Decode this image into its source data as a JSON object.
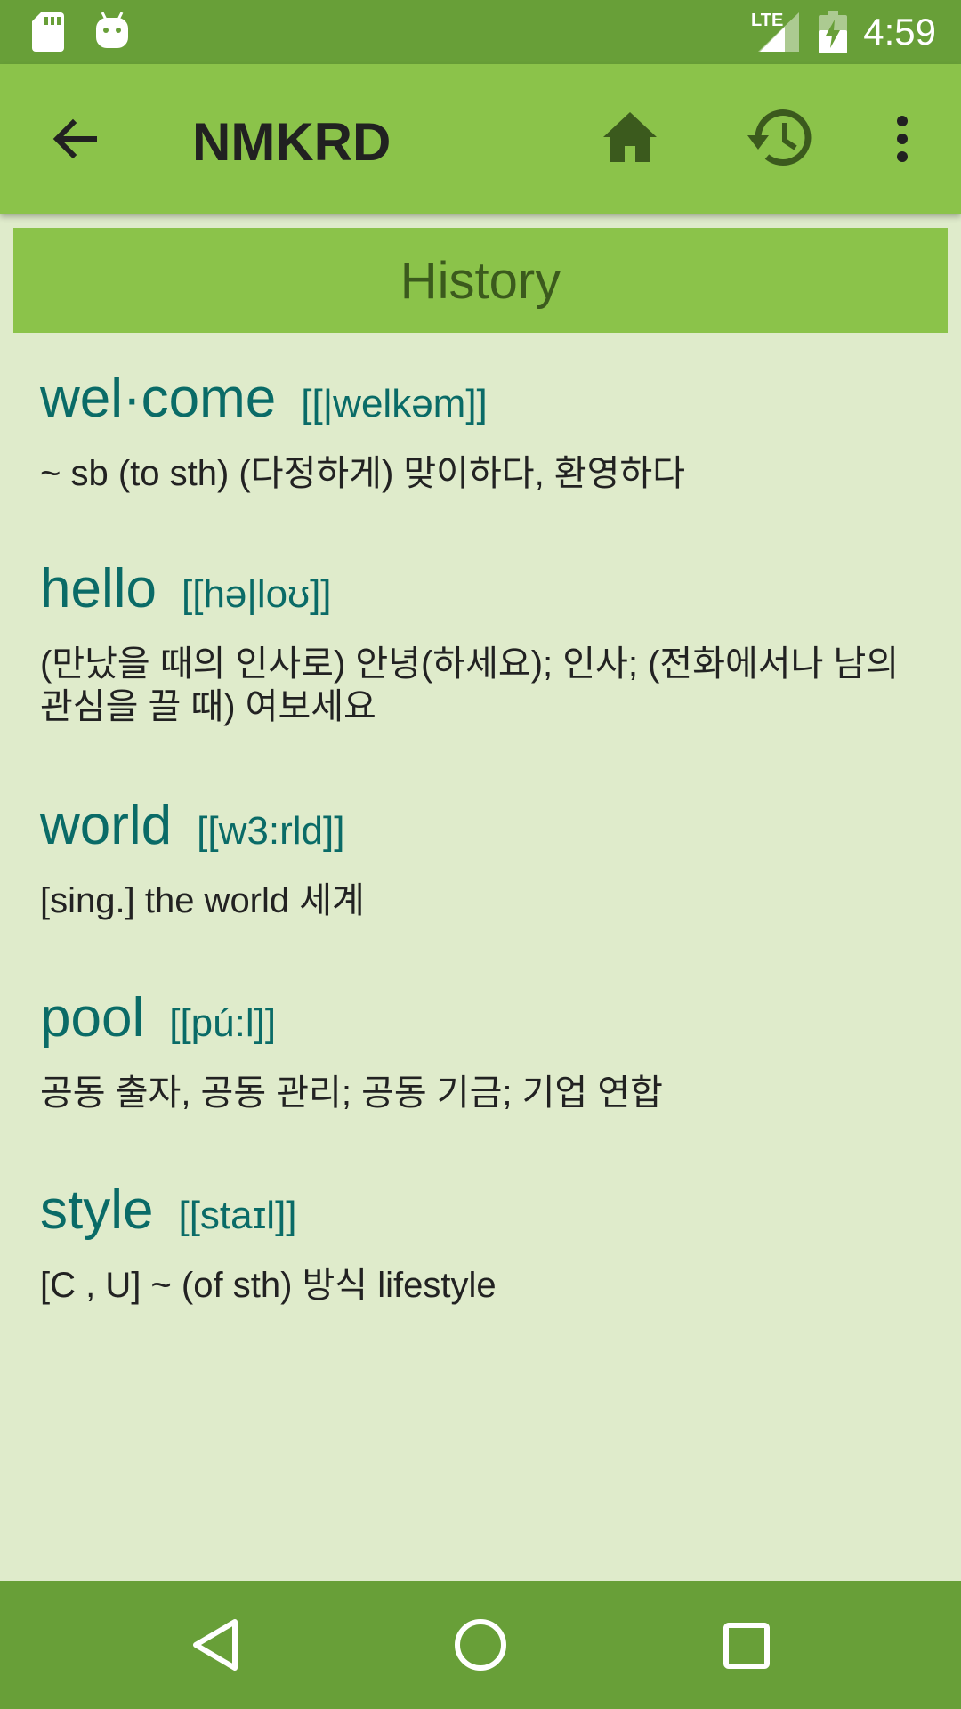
{
  "status_bar": {
    "time": "4:59",
    "network_label": "LTE",
    "icons": [
      "sd-card-icon",
      "android-icon",
      "lte-signal-icon",
      "battery-charging-icon"
    ]
  },
  "app_bar": {
    "title": "NMKRD",
    "icons": [
      "back-arrow-icon",
      "home-icon",
      "history-icon",
      "more-vert-icon"
    ]
  },
  "section": {
    "title": "History"
  },
  "entries": [
    {
      "word": "wel·come",
      "pronunciation": "[[|welkəm]]",
      "definition": "~ sb (to sth) (다정하게) 맞이하다, 환영하다"
    },
    {
      "word": "hello",
      "pronunciation": "[[hə|loʊ]]",
      "definition": "(만났을 때의 인사로) 안녕(하세요); 인사; (전화에서나 남의 관심을 끌 때) 여보세요"
    },
    {
      "word": "world",
      "pronunciation": "[[w3:rld]]",
      "definition": "[sing.] the world 세계"
    },
    {
      "word": "pool",
      "pronunciation": "[[pú:l]]",
      "definition": "공동 출자, 공동 관리; 공동 기금; 기업 연합"
    },
    {
      "word": "style",
      "pronunciation": "[[staɪl]]",
      "definition": "[C , U] ~ (of sth) 방식 lifestyle"
    }
  ],
  "nav_bar": {
    "icons": [
      "back-triangle-icon",
      "home-circle-icon",
      "recents-square-icon"
    ]
  },
  "colors": {
    "status_bar": "#689f38",
    "app_bar": "#8bc34a",
    "background": "#dfebcb",
    "word_text": "#0a6b67",
    "section_title_text": "#3b5a1d"
  }
}
